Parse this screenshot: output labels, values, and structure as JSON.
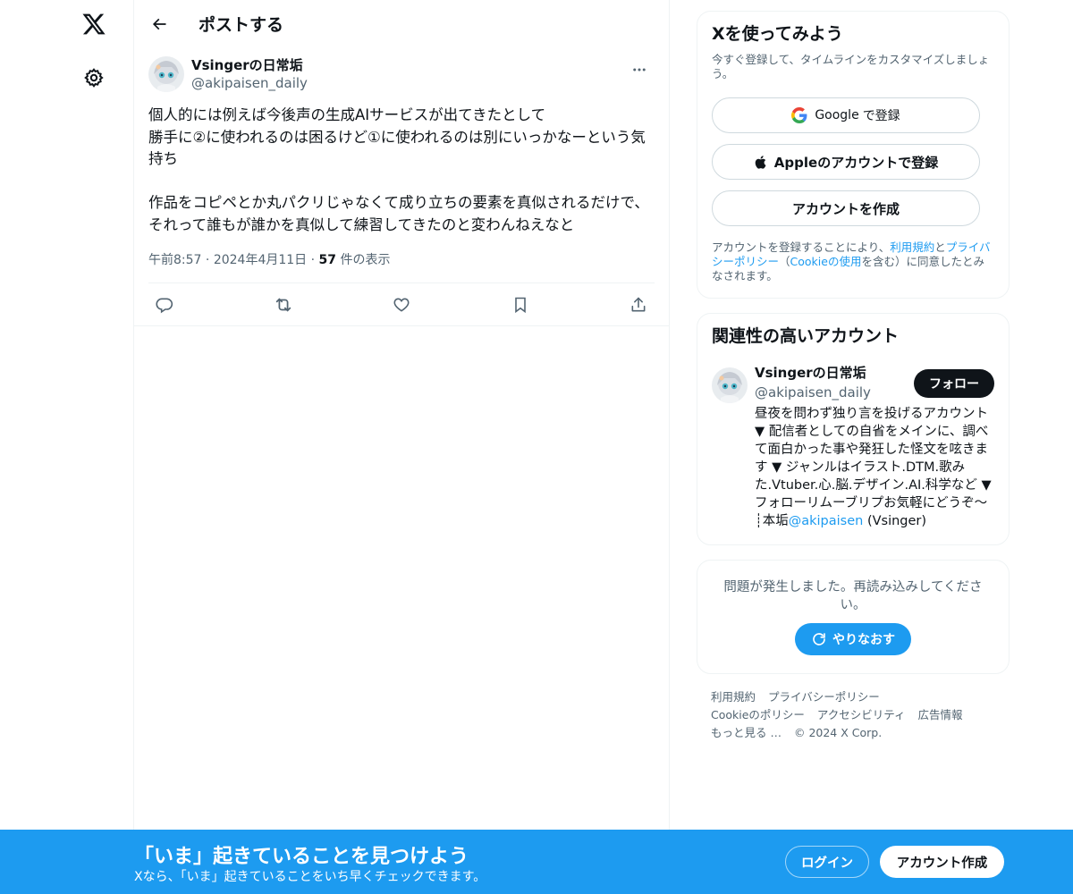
{
  "nav": {
    "logo_icon": "x-logo-icon",
    "settings_icon": "gear-icon"
  },
  "header": {
    "title": "ポストする",
    "back_icon": "arrow-left-icon"
  },
  "tweet": {
    "author_name": "Vsingerの日常垢",
    "author_handle": "@akipaisen_daily",
    "text": "個人的には例えば今後声の生成AIサービスが出てきたとして\n勝手に②に使われるのは困るけど①に使われるのは別にいっかなーという気持ち\n\n作品をコピペとか丸パクリじゃなくて成り立ちの要素を真似されるだけで、それって誰もが誰かを真似して練習してきたのと変わんねえなと",
    "time": "午前8:57",
    "date": "2024年4月11日",
    "separator": "·",
    "views_count": "57",
    "views_label": "件の表示"
  },
  "signup": {
    "title": "Xを使ってみよう",
    "subtitle": "今すぐ登録して、タイムラインをカスタマイズしましょう。",
    "google_prefix": "Google",
    "google_suffix": "で登録",
    "apple_label": "Appleのアカウントで登録",
    "create_label": "アカウントを作成",
    "terms_1": "アカウントを登録することにより、",
    "terms_link_1": "利用規約",
    "terms_2": "と",
    "terms_link_2": "プライバシーポリシー",
    "terms_3": "（",
    "terms_link_3": "Cookieの使用",
    "terms_4": "を含む）に同意したとみなされます。"
  },
  "related": {
    "title": "関連性の高いアカウント",
    "name": "Vsingerの日常垢",
    "handle": "@akipaisen_daily",
    "follow_label": "フォロー",
    "bio_text": "昼夜を問わず独り言を投げるアカウント▼ 配信者としての自省をメインに、調べて面白かった事や発狂した怪文を呟きます ▼ ジャンルはイラスト.DTM.歌みた.Vtuber.心.脳.デザイン.AI.科学など ▼ フォローリムーブリプお気軽にどうぞ〜┊本垢",
    "bio_link": "@akipaisen",
    "bio_tail": " (Vsinger)"
  },
  "error": {
    "text": "問題が発生しました。再読み込みしてください。",
    "retry_label": "やりなおす"
  },
  "footer": {
    "terms": "利用規約",
    "privacy": "プライバシーポリシー",
    "cookie": "Cookieのポリシー",
    "accessibility": "アクセシビリティ",
    "ads": "広告情報",
    "more": "もっと見る …",
    "copyright": "© 2024 X Corp."
  },
  "banner": {
    "title": "「いま」起きていることを見つけよう",
    "subtitle": "Xなら、「いま」起きていることをいち早くチェックできます。",
    "login_label": "ログイン",
    "create_label": "アカウント作成"
  },
  "colors": {
    "accent": "#1d9bf0",
    "text": "#0f1419",
    "secondary": "#536471",
    "border": "#eff3f4"
  }
}
